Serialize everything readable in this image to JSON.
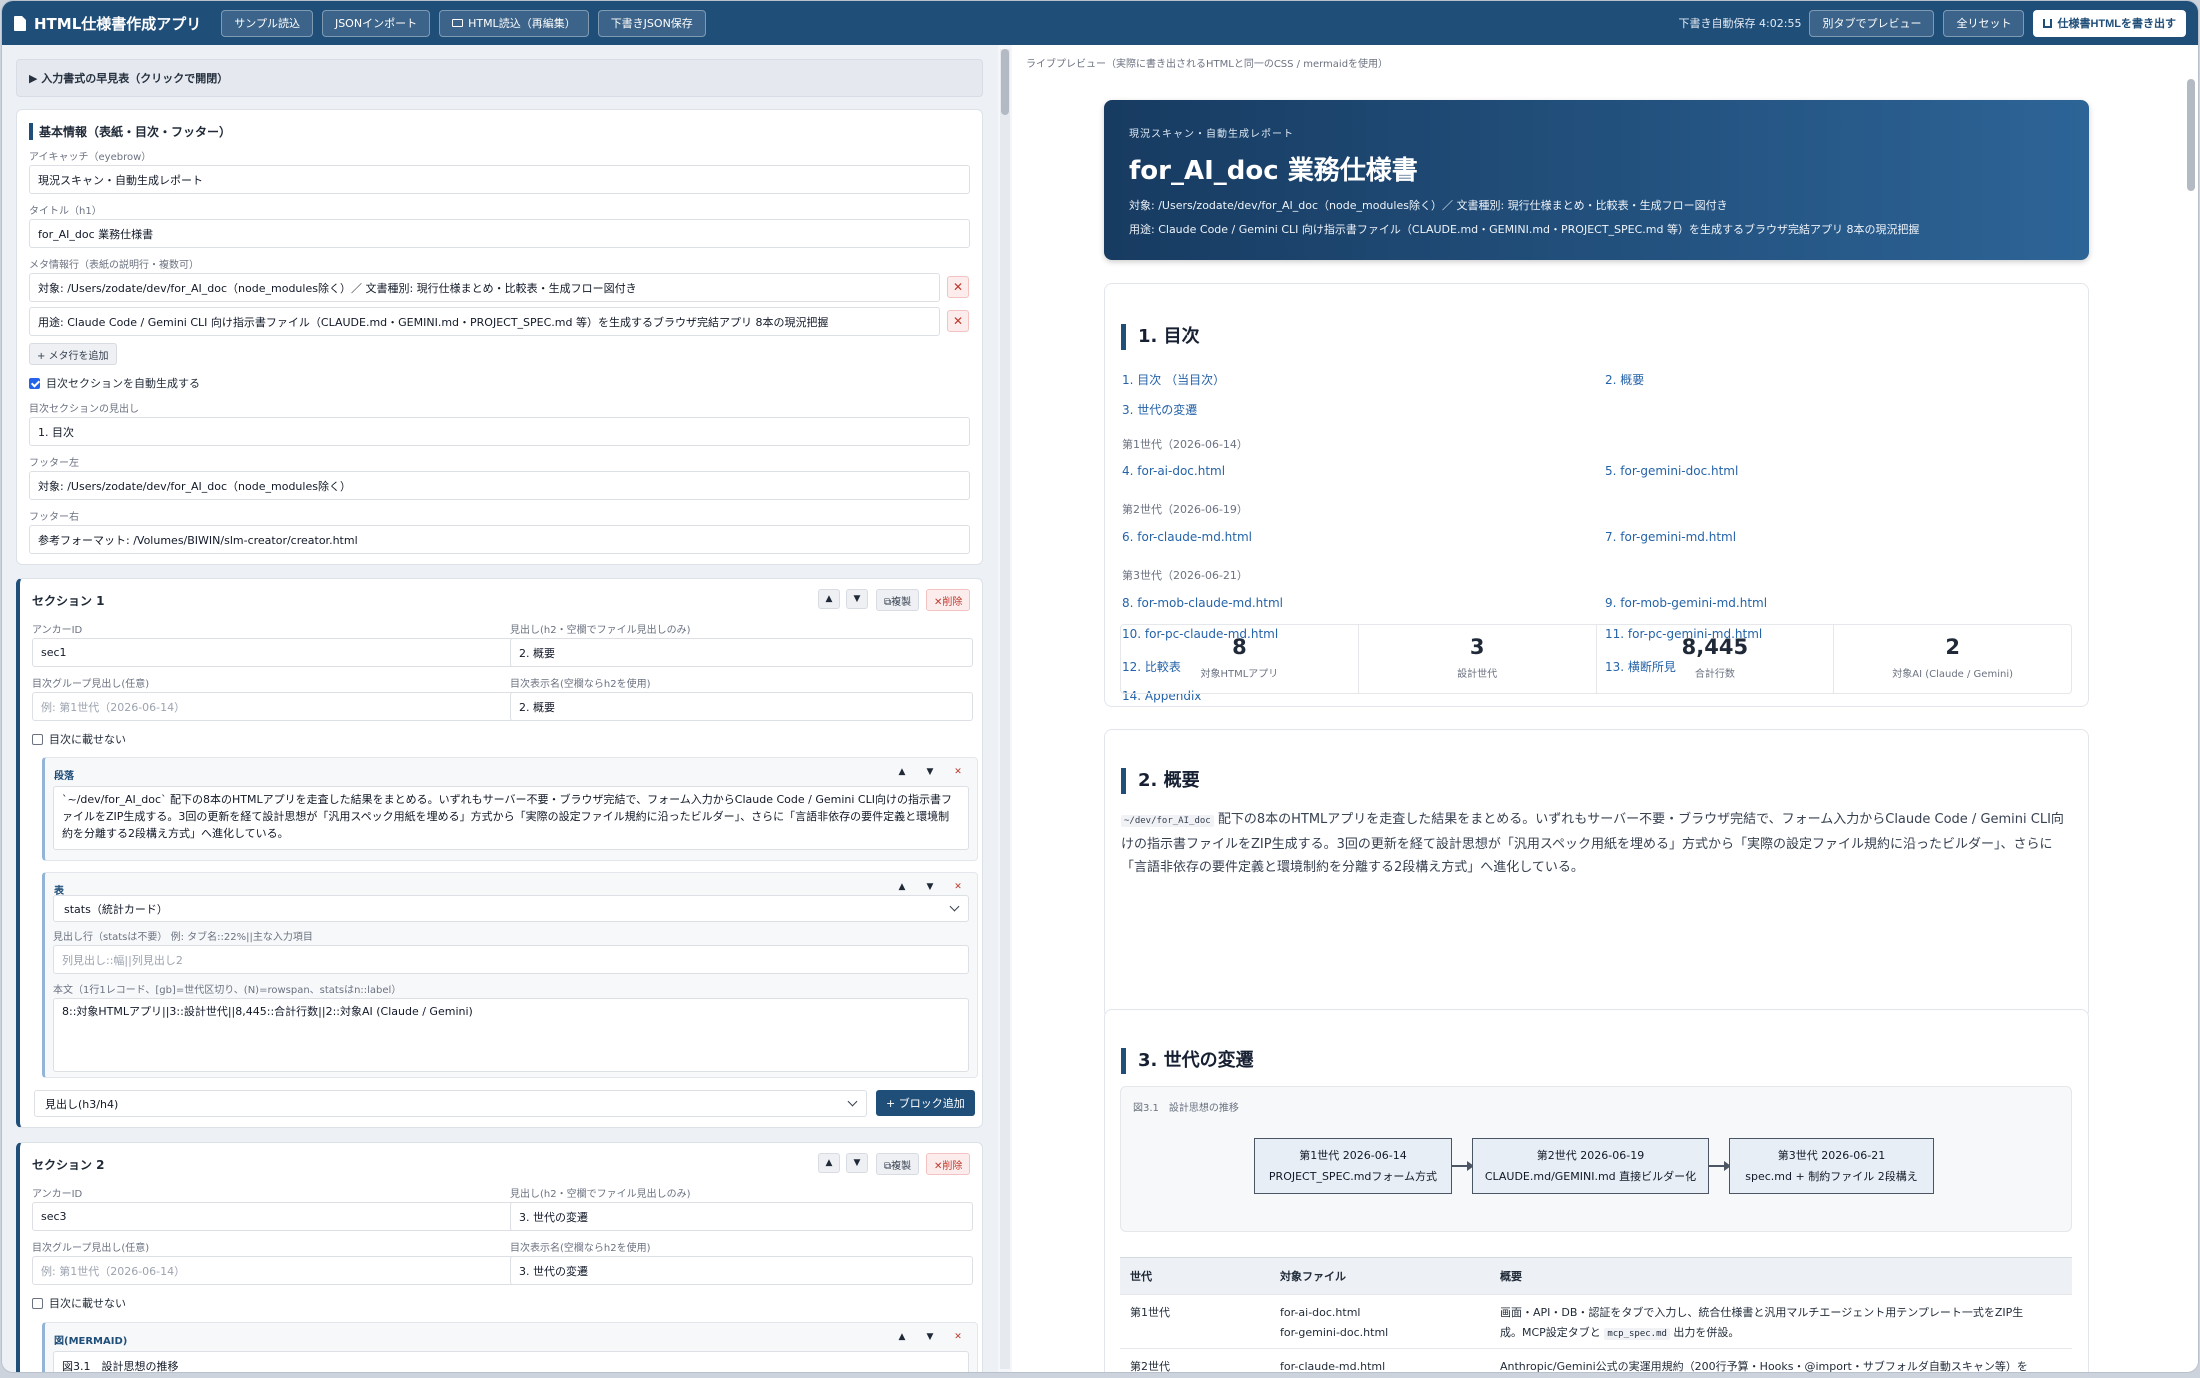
{
  "app": {
    "title": "HTML仕様書作成アプリ",
    "toolbar": [
      "サンプル読込",
      "JSONインポート",
      "HTML読込（再編集）",
      "下書きJSON保存"
    ],
    "autosave": "下書き自動保存 4:02:55",
    "preview_tab": "別タブでプレビュー",
    "reset": "全リセット",
    "export": "仕様書HTMLを書き出す"
  },
  "editor": {
    "cheatsheet": "▶ 入力書式の早見表（クリックで開閉）",
    "basic": {
      "title": "基本情報（表紙・目次・フッター）",
      "eyebrow_label": "アイキャッチ（eyebrow）",
      "eyebrow": "現況スキャン・自動生成レポート",
      "title_label": "タイトル（h1）",
      "title_value": "for_AI_doc 業務仕様書",
      "meta_label": "メタ情報行（表紙の説明行・複数可）",
      "meta": [
        "対象: /Users/zodate/dev/for_AI_doc（node_modules除く）／ 文書種別: 現行仕様まとめ・比較表・生成フロー図付き",
        "用途: Claude Code / Gemini CLI 向け指示書ファイル（CLAUDE.md・GEMINI.md・PROJECT_SPEC.md 等）を生成するブラウザ完結アプリ 8本の現況把握"
      ],
      "add_meta": "+ メタ行を追加",
      "toc_auto": "目次セクションを自動生成する",
      "toc_heading_label": "目次セクションの見出し",
      "toc_heading": "1. 目次",
      "footer_left_label": "フッター左",
      "footer_left": "対象: /Users/zodate/dev/for_AI_doc（node_modules除く）",
      "footer_right_label": "フッター右",
      "footer_right": "参考フォーマット: /Volumes/BIWIN/slm-creator/creator.html"
    },
    "common": {
      "anchor_label": "アンカーID",
      "heading_label": "見出し(h2・空欄でファイル見出しのみ)",
      "group_label": "目次グループ見出し(任意)",
      "group_placeholder": "例: 第1世代（2026-06-14）",
      "toc_name_label": "目次表示名(空欄ならh2を使用)",
      "no_toc": "目次に載せない",
      "up": "▲",
      "down": "▼",
      "copy": "⧉複製",
      "delete": "✕削除",
      "x": "✕"
    },
    "section1": {
      "title": "セクション 1",
      "anchor": "sec1",
      "heading": "2. 概要",
      "toc_name": "2. 概要",
      "para_type": "段落",
      "para_text": "`~/dev/for_AI_doc` 配下の8本のHTMLアプリを走査した結果をまとめる。いずれもサーバー不要・ブラウザ完結で、フォーム入力からClaude Code / Gemini CLI向けの指示書ファイルをZIP生成する。3回の更新を経て設計思想が「汎用スペック用紙を埋める」方式から「実際の設定ファイル規約に沿ったビルダー」、さらに「言語非依存の要件定義と環境制約を分離する2段構え方式」へ進化している。",
      "table_type": "表",
      "table_kind": "stats（統計カード）",
      "header_label": "見出し行（statsは不要） 例: タブ名::22%||主な入力項目",
      "header_placeholder": "列見出し::幅||列見出し2",
      "body_label": "本文（1行1レコード、[gb]=世代区切り、(N)=rowspan、statsはn::label）",
      "body_value": "8::対象HTMLアプリ||3::設計世代||8,445::合計行数||2::対象AI (Claude / Gemini)",
      "block_select": "見出し(h3/h4)",
      "add_block": "+ ブロック追加"
    },
    "section2": {
      "title": "セクション 2",
      "anchor": "sec3",
      "heading": "3. 世代の変遷",
      "toc_name": "3. 世代の変遷",
      "mermaid_type": "図(MERMAID)",
      "mermaid_caption": "図3.1　設計思想の推移"
    }
  },
  "preview": {
    "label": "ライブプレビュー（実際に書き出されるHTMLと同一のCSS / mermaidを使用）",
    "hero": {
      "eyebrow": "現況スキャン・自動生成レポート",
      "title": "for_AI_doc 業務仕様書",
      "meta1": "対象: /Users/zodate/dev/for_AI_doc（node_modules除く）／ 文書種別: 現行仕様まとめ・比較表・生成フロー図付き",
      "meta2": "用途: Claude Code / Gemini CLI 向け指示書ファイル（CLAUDE.md・GEMINI.md・PROJECT_SPEC.md 等）を生成するブラウザ完結アプリ 8本の現況把握"
    },
    "toc": {
      "heading": "1. 目次",
      "top": [
        "1. 目次 （当目次）",
        "2. 概要",
        "3. 世代の変遷"
      ],
      "gen1": "第1世代（2026-06-14）",
      "gen1_items": [
        "4. for-ai-doc.html",
        "5. for-gemini-doc.html"
      ],
      "gen2": "第2世代（2026-06-19）",
      "gen2_items": [
        "6. for-claude-md.html",
        "7. for-gemini-md.html"
      ],
      "gen3": "第3世代（2026-06-21）",
      "gen3_items": [
        "8. for-mob-claude-md.html",
        "9. for-mob-gemini-md.html",
        "10. for-pc-claude-md.html",
        "11. for-pc-gemini-md.html",
        "12. 比較表",
        "13. 横断所見",
        "14. Appendix"
      ]
    },
    "overview": {
      "heading": "2. 概要",
      "code": "~/dev/for_AI_doc",
      "text": " 配下の8本のHTMLアプリを走査した結果をまとめる。いずれもサーバー不要・ブラウザ完結で、フォーム入力からClaude Code / Gemini CLI向けの指示書ファイルをZIP生成する。3回の更新を経て設計思想が「汎用スペック用紙を埋める」方式から「実際の設定ファイル規約に沿ったビルダー」、さらに「言語非依存の要件定義と環境制約を分離する2段構え方式」へ進化している。",
      "stats": [
        {
          "num": "8",
          "label": "対象HTMLアプリ"
        },
        {
          "num": "3",
          "label": "設計世代"
        },
        {
          "num": "8,445",
          "label": "合計行数"
        },
        {
          "num": "2",
          "label": "対象AI (Claude / Gemini)"
        }
      ]
    },
    "generations": {
      "heading": "3. 世代の変遷",
      "caption": "図3.1　設計思想の推移",
      "nodes": [
        {
          "l1": "第1世代 2026-06-14",
          "l2": "PROJECT_SPEC.mdフォーム方式"
        },
        {
          "l1": "第2世代 2026-06-19",
          "l2": "CLAUDE.md/GEMINI.md 直接ビルダー化"
        },
        {
          "l1": "第3世代 2026-06-21",
          "l2": "spec.md + 制約ファイル 2段構え"
        }
      ],
      "headers": [
        "世代",
        "対象ファイル",
        "概要"
      ],
      "row1": {
        "gen": "第1世代",
        "file1": "for-ai-doc.html",
        "file2": "for-gemini-doc.html",
        "sum1": "画面・API・DB・認証をタブで入力し、統合仕様書と汎用マルチエージェント用テンプレート一式をZIP生",
        "sum2a": "成。MCP設定タブと",
        "sum2code": "mcp_spec.md",
        "sum2b": "出力を併設。"
      },
      "row2": {
        "gen": "第2世代",
        "file1": "for-claude-md.html",
        "sum1": "Anthropic/Gemini公式の実運用規約（200行予算・Hooks・@import・サブフォルダ自動スキャン等）を"
      }
    }
  }
}
